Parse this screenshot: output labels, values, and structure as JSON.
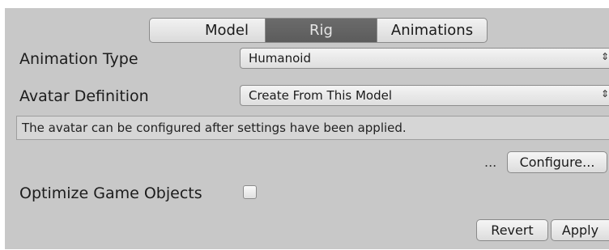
{
  "tabs": {
    "model": "Model",
    "rig": "Rig",
    "animations": "Animations"
  },
  "fields": {
    "animation_type_label": "Animation Type",
    "animation_type_value": "Humanoid",
    "avatar_definition_label": "Avatar Definition",
    "avatar_definition_value": "Create From This Model",
    "dropdown_arrow": "⇕"
  },
  "help_text": "The avatar can be configured after settings have been applied.",
  "configure": {
    "ellipsis": "...",
    "button_label": "Configure..."
  },
  "optimize": {
    "label": "Optimize Game Objects",
    "checked": false
  },
  "footer": {
    "revert_label": "Revert",
    "apply_label": "Apply"
  },
  "colors": {
    "panel_background": "#c8c8c8",
    "active_tab": "#5f5f5f"
  }
}
